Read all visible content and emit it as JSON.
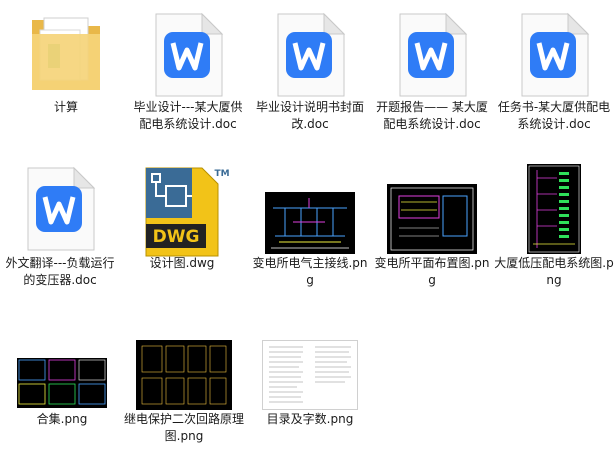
{
  "files": [
    {
      "name": "计算",
      "type": "folder",
      "icon": "folder-icon"
    },
    {
      "name": "毕业设计---某大厦供配电系统设计.doc",
      "type": "doc",
      "icon": "wps-writer-icon"
    },
    {
      "name": "毕业设计说明书封面改.doc",
      "type": "doc",
      "icon": "wps-writer-icon"
    },
    {
      "name": "开题报告—— 某大厦配电系统设计.doc",
      "type": "doc",
      "icon": "wps-writer-icon"
    },
    {
      "name": "任务书-某大厦供配电系统设计.doc",
      "type": "doc",
      "icon": "wps-writer-icon"
    },
    {
      "name": "外文翻译---负载运行的变压器.doc",
      "type": "doc",
      "icon": "wps-writer-icon"
    },
    {
      "name": "设计图.dwg",
      "type": "dwg",
      "icon": "dwg-file-icon",
      "badge": "DWG",
      "tm": "TM"
    },
    {
      "name": "变电所电气主接线.png",
      "type": "png",
      "icon": "png-thumbnail"
    },
    {
      "name": "变电所平面布置图.png",
      "type": "png",
      "icon": "png-thumbnail"
    },
    {
      "name": "大厦低压配电系统图.png",
      "type": "png",
      "icon": "png-thumbnail"
    },
    {
      "name": "合集.png",
      "type": "png",
      "icon": "png-thumbnail"
    },
    {
      "name": "继电保护二次回路原理图.png",
      "type": "png",
      "icon": "png-thumbnail"
    },
    {
      "name": "目录及字数.png",
      "type": "png",
      "icon": "png-thumbnail"
    }
  ],
  "colors": {
    "wps_blue": "#2f7cf6",
    "dwg_yellow": "#f2c318",
    "folder_yellow": "#f5d47a"
  }
}
